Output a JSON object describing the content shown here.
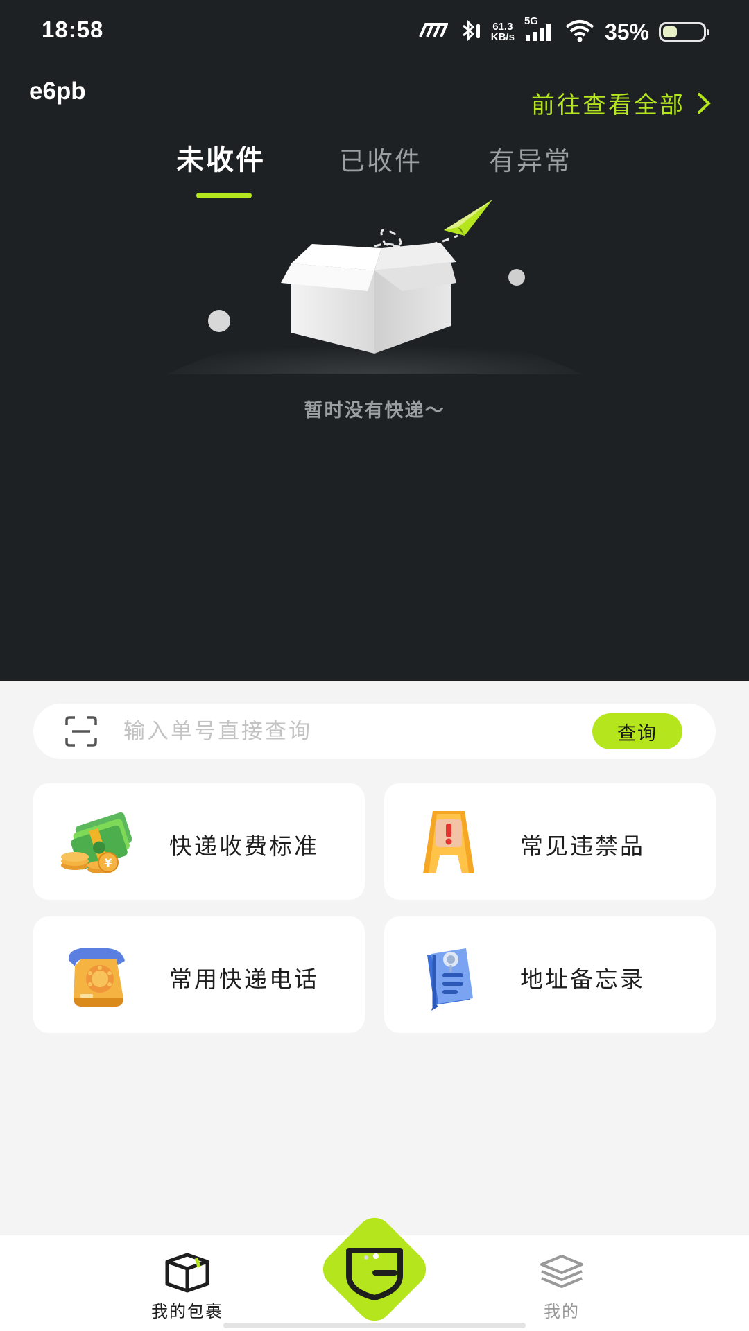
{
  "status_bar": {
    "time": "18:58",
    "net_speed_value": "61.3",
    "net_speed_unit": "KB/s",
    "network_type": "5G",
    "battery_percent": "35%",
    "battery_level": 0.35
  },
  "header": {
    "brand": "e6pb",
    "view_all_label": "前往查看全部"
  },
  "tabs": [
    {
      "label": "未收件",
      "active": true
    },
    {
      "label": "已收件",
      "active": false
    },
    {
      "label": "有异常",
      "active": false
    }
  ],
  "empty_state": {
    "message": "暂时没有快递～"
  },
  "search": {
    "placeholder": "输入单号直接查询",
    "button_label": "查询"
  },
  "services": [
    {
      "label": "快递收费标准",
      "icon": "money-coins-icon"
    },
    {
      "label": "常见违禁品",
      "icon": "warning-sign-icon"
    },
    {
      "label": "常用快递电话",
      "icon": "telephone-icon"
    },
    {
      "label": "地址备忘录",
      "icon": "address-book-icon"
    }
  ],
  "bottom_nav": {
    "items": [
      {
        "label": "我的包裹",
        "icon": "package-box-icon",
        "active": true
      },
      {
        "label": "我的",
        "icon": "layers-icon",
        "active": false
      }
    ],
    "center_icon": "shield-logo-icon"
  },
  "colors": {
    "accent": "#b5e61d",
    "header_bg": "#1d2123",
    "page_bg": "#f4f4f4"
  }
}
